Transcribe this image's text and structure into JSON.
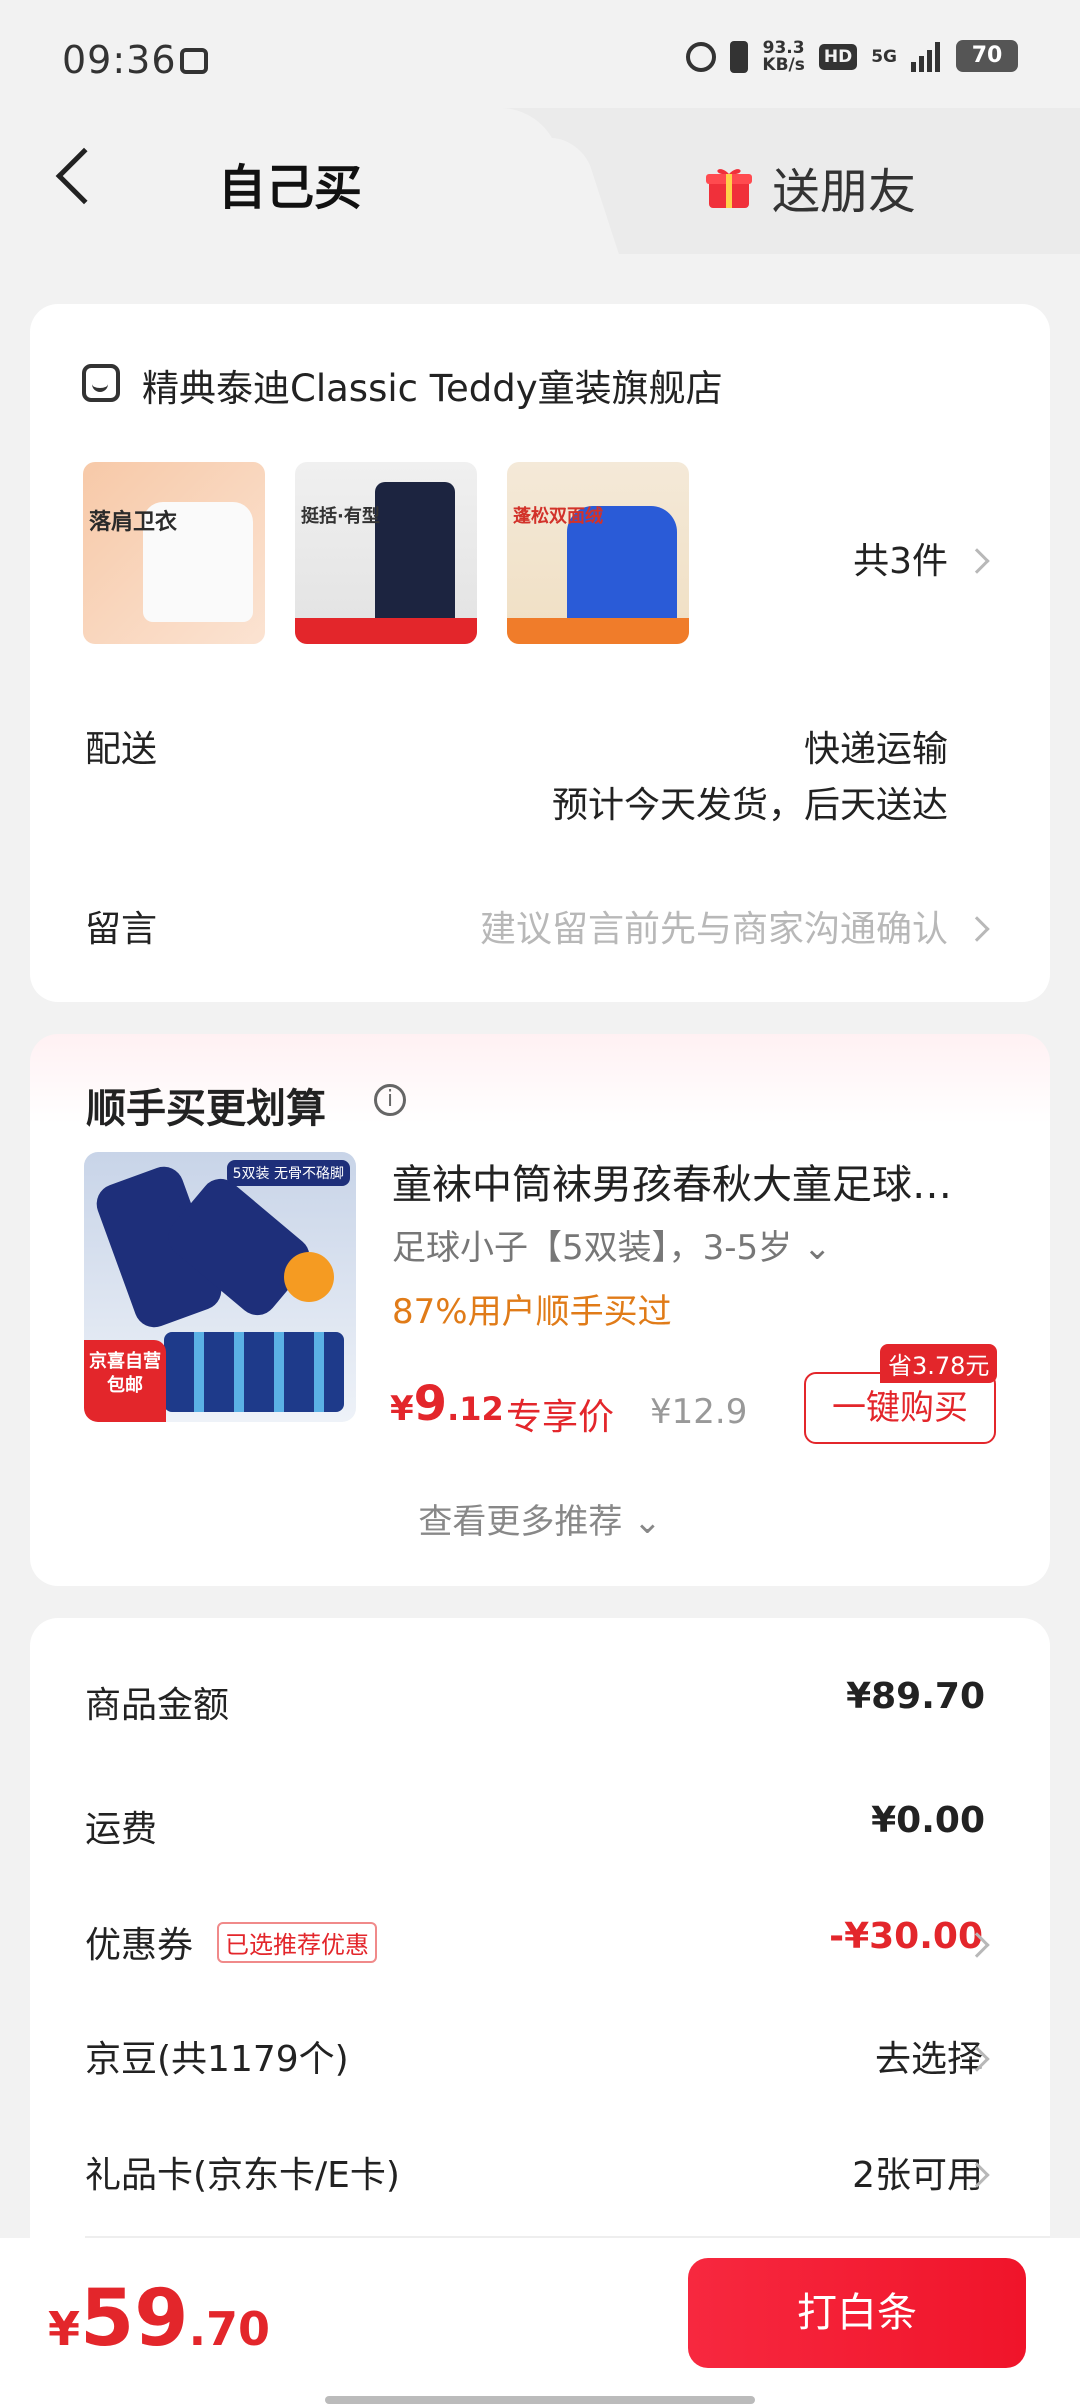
{
  "status_bar": {
    "time": "09:36",
    "net_speed_value": "93.3",
    "net_speed_unit": "KB/s",
    "hd": "HD",
    "net_type": "5G",
    "battery": "70"
  },
  "tabs": {
    "self_buy": "自己买",
    "gift_friend": "送朋友"
  },
  "store": {
    "name": "精典泰迪Classic Teddy童装旗舰店",
    "thumb_labels": [
      "落肩卫衣",
      "挺括·有型",
      "蓬松双面绒"
    ],
    "item_count": "共3件"
  },
  "delivery": {
    "label": "配送",
    "method": "快递运输",
    "eta": "预计今天发货，后天送达"
  },
  "note": {
    "label": "留言",
    "placeholder": "建议留言前先与商家沟通确认"
  },
  "recommend": {
    "title": "顺手买更划算",
    "product_name": "童袜中筒袜男孩春秋大童足球…",
    "spec": "足球小子【5双装】，3-5岁",
    "bought_ratio": "87%用户顺手买过",
    "price_currency": "¥",
    "price_int": "9",
    "price_dec": ".12",
    "price_tag": "专享价",
    "original_price": "¥12.9",
    "save_badge": "省3.78元",
    "buy_button": "一键购买",
    "image_tag": "京喜自营 包邮",
    "image_top_tag": "5双装 无骨不硌脚",
    "more": "查看更多推荐"
  },
  "summary": {
    "goods_amount_label": "商品金额",
    "goods_amount": "¥89.70",
    "shipping_label": "运费",
    "shipping": "¥0.00",
    "coupon_label": "优惠券",
    "coupon_badge": "已选推荐优惠",
    "coupon_value": "-¥30.00",
    "jingdou_label": "京豆(共1179个)",
    "jingdou_value": "去选择",
    "giftcard_label": "礼品卡(京东卡/E卡)",
    "giftcard_value": "2张可用"
  },
  "footer": {
    "total_currency": "¥",
    "total_int": "59",
    "total_dec": ".70",
    "pay_button": "打白条"
  },
  "colors": {
    "accent": "#e3262b",
    "orange": "#e07b18",
    "background": "#f2f2f2"
  }
}
